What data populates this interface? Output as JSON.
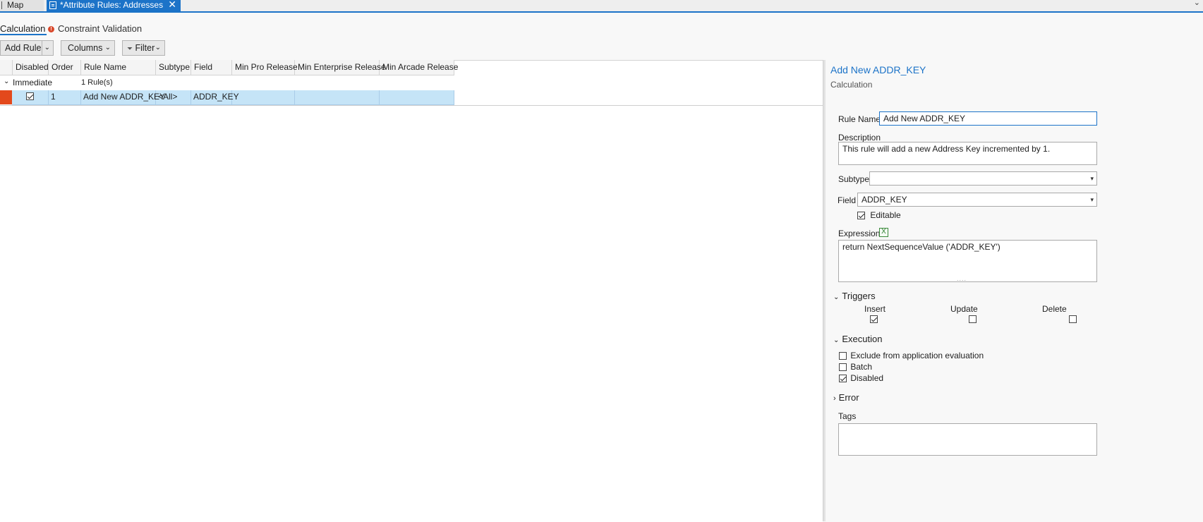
{
  "tabs": {
    "map_label": "Map",
    "active_label": "*Attribute Rules: Addresses",
    "close_glyph": "✕"
  },
  "rule_tabs": {
    "calculation": "Calculation",
    "constraint": "Constraint",
    "validation": "Validation",
    "warning_glyph": "!"
  },
  "toolbar": {
    "add_rule": "Add Rule",
    "columns": "Columns",
    "filter": "Filter",
    "caret": "⌄"
  },
  "grid": {
    "columns": [
      "Disabled",
      "Order",
      "Rule Name",
      "Subtype",
      "Field",
      "Min Pro Release",
      "Min Enterprise Release",
      "Min Arcade Release"
    ],
    "group": {
      "label": "Immediate",
      "count": "1 Rule(s)"
    },
    "rows": [
      {
        "disabled": true,
        "order": "1",
        "rule_name": "Add New ADDR_KEY",
        "subtype": "<All>",
        "field": "ADDR_KEY",
        "min_pro": "",
        "min_enterprise": "",
        "min_arcade": ""
      }
    ]
  },
  "details": {
    "title": "Add New ADDR_KEY",
    "subtitle": "Calculation",
    "rule_name_label": "Rule Name",
    "rule_name_value": "Add New ADDR_KEY",
    "description_label": "Description",
    "description_value": "This rule will add a new Address Key incremented by 1.",
    "subtype_label": "Subtype",
    "subtype_value": "",
    "field_label": "Field",
    "field_value": "ADDR_KEY",
    "editable_label": "Editable",
    "editable_checked": true,
    "expression_label": "Expression",
    "expression_value": "return NextSequenceValue ('ADDR_KEY')",
    "triggers_label": "Triggers",
    "triggers": {
      "insert_label": "Insert",
      "insert_checked": true,
      "update_label": "Update",
      "update_checked": false,
      "delete_label": "Delete",
      "delete_checked": false
    },
    "execution_label": "Execution",
    "execution": {
      "exclude_label": "Exclude from application evaluation",
      "exclude_checked": false,
      "batch_label": "Batch",
      "batch_checked": false,
      "disabled_label": "Disabled",
      "disabled_checked": true
    },
    "error_label": "Error",
    "tags_label": "Tags",
    "tags_value": ""
  },
  "colors": {
    "accent": "#1c73c8",
    "error_marker": "#e3491c",
    "selected_row": "#c5e4f7"
  }
}
